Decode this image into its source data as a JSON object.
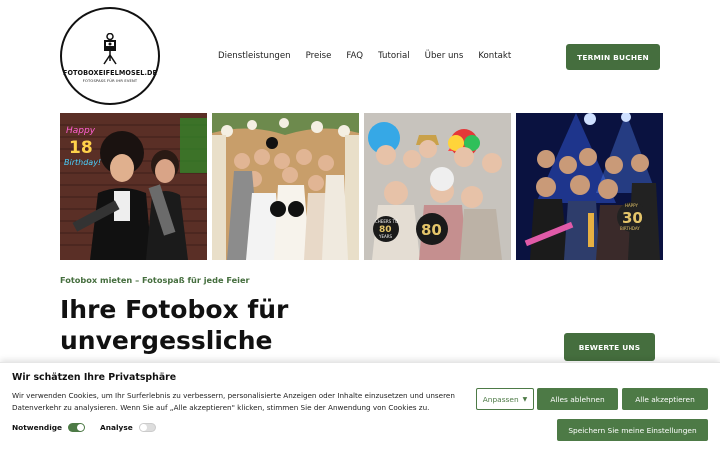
{
  "header": {
    "logo": {
      "title": "FOTOBOXEIFELMOSEL.DE",
      "subtitle": "FOTOSPASS FÜR IHR EVENT"
    },
    "nav": [
      "Dienstleistungen",
      "Preise",
      "FAQ",
      "Tutorial",
      "Über uns",
      "Kontakt"
    ],
    "cta": "TERMIN BUCHEN"
  },
  "gallery": {
    "photos": [
      {
        "sign_line1": "Happy",
        "sign_line2": "18",
        "sign_line3": "Birthday!"
      },
      {
        "prop": "Fotobox"
      },
      {
        "sign_top": "CHEERS TO",
        "sign_num": "80",
        "sign_bottom": "YEARS",
        "balloon": "80"
      },
      {
        "sign_top": "HAPPY",
        "sign_num": "30",
        "sign_bottom": "BIRTHDAY"
      }
    ]
  },
  "hero": {
    "tagline": "Fotobox mieten – Fotospaß für jede Feier",
    "title": "Ihre Fotobox für unvergessliche",
    "reviews_button": "BEWERTE UNS"
  },
  "cookie": {
    "title": "Wir schätzen Ihre Privatsphäre",
    "text": "Wir verwenden Cookies, um Ihr Surferlebnis zu verbessern, personalisierte Anzeigen oder Inhalte einzusetzen und unseren Datenverkehr zu analysieren. Wenn Sie auf „Alle akzeptieren\" klicken, stimmen Sie der Anwendung von Cookies zu.",
    "customize": "Anpassen",
    "reject": "Alles ablehnen",
    "accept": "Alle akzeptieren",
    "save": "Speichern Sie meine Einstellungen",
    "toggles": [
      {
        "label": "Notwendige",
        "on": true
      },
      {
        "label": "Analyse",
        "on": false
      }
    ]
  },
  "colors": {
    "brand_green": "#456e3e",
    "cookie_green": "#4d7a46"
  }
}
